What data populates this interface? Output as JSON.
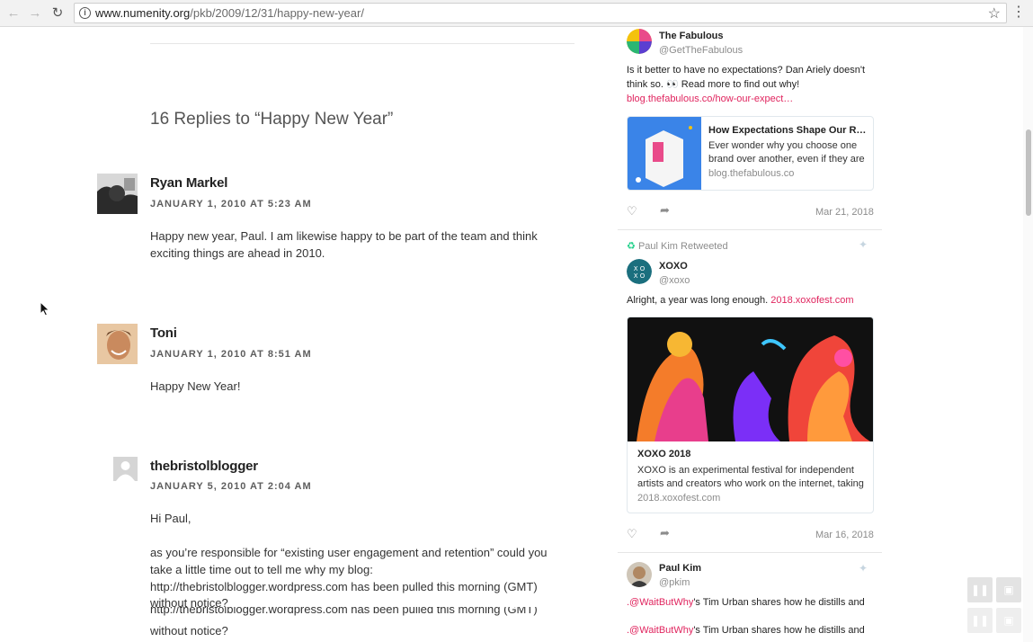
{
  "browser": {
    "url_host": "www.numenity.org",
    "url_path": "/pkb/2009/12/31/happy-new-year/"
  },
  "replies_title": "16 Replies to “Happy New Year”",
  "comments": [
    {
      "author": "Ryan Markel",
      "date": "JANUARY 1, 2010 AT 5:23 AM",
      "paragraphs": [
        "Happy new year, Paul. I am likewise happy to be part of the team and think exciting things are ahead in 2010."
      ]
    },
    {
      "author": "Toni",
      "date": "JANUARY 1, 2010 AT 8:51 AM",
      "paragraphs": [
        "Happy New Year!"
      ]
    },
    {
      "author": "thebristolblogger",
      "date": "JANUARY 5, 2010 AT 2:04 AM",
      "paragraphs": [
        "Hi Paul,",
        "as you’re responsible for “existing user engagement and retention” could you take a little time out to tell me why my blog:",
        "http://thebristolblogger.wordpress.com has been pulled this morning (GMT)",
        "without notice?",
        "http://thebristolblogger.wordpress.com has been pulled this morning (GMT)",
        "without notice?"
      ]
    }
  ],
  "tweets": [
    {
      "name": "The Fabulous",
      "handle": "@GetTheFabulous",
      "text": "Is it better to have no expectations? Dan Ariely doesn't think so. 👀 Read more to find out why!",
      "link": "blog.thefabulous.co/how-our-expect…",
      "card": {
        "title": "How Expectations Shape Our R…",
        "desc": "Ever wonder why you choose one brand over another, even if they are",
        "host": "blog.thefabulous.co"
      },
      "date": "Mar 21, 2018"
    },
    {
      "retweeted_by": "Paul Kim Retweeted",
      "name": "XOXO",
      "handle": "@xoxo",
      "text": "Alright, a year was long enough. ",
      "link": "2018.xoxofest.com",
      "card": {
        "title": "XOXO 2018",
        "desc": "XOXO is an experimental festival for independent artists and creators who work on the internet, taking",
        "host": "2018.xoxofest.com"
      },
      "date": "Mar 16, 2018"
    },
    {
      "name": "Paul Kim",
      "handle": "@pkim",
      "mention": ".@WaitButWhy",
      "text": "'s Tim Urban shares how he distills and"
    }
  ],
  "colors": {
    "link": "#e0245e",
    "accent_grey": "#8c8c8c"
  }
}
